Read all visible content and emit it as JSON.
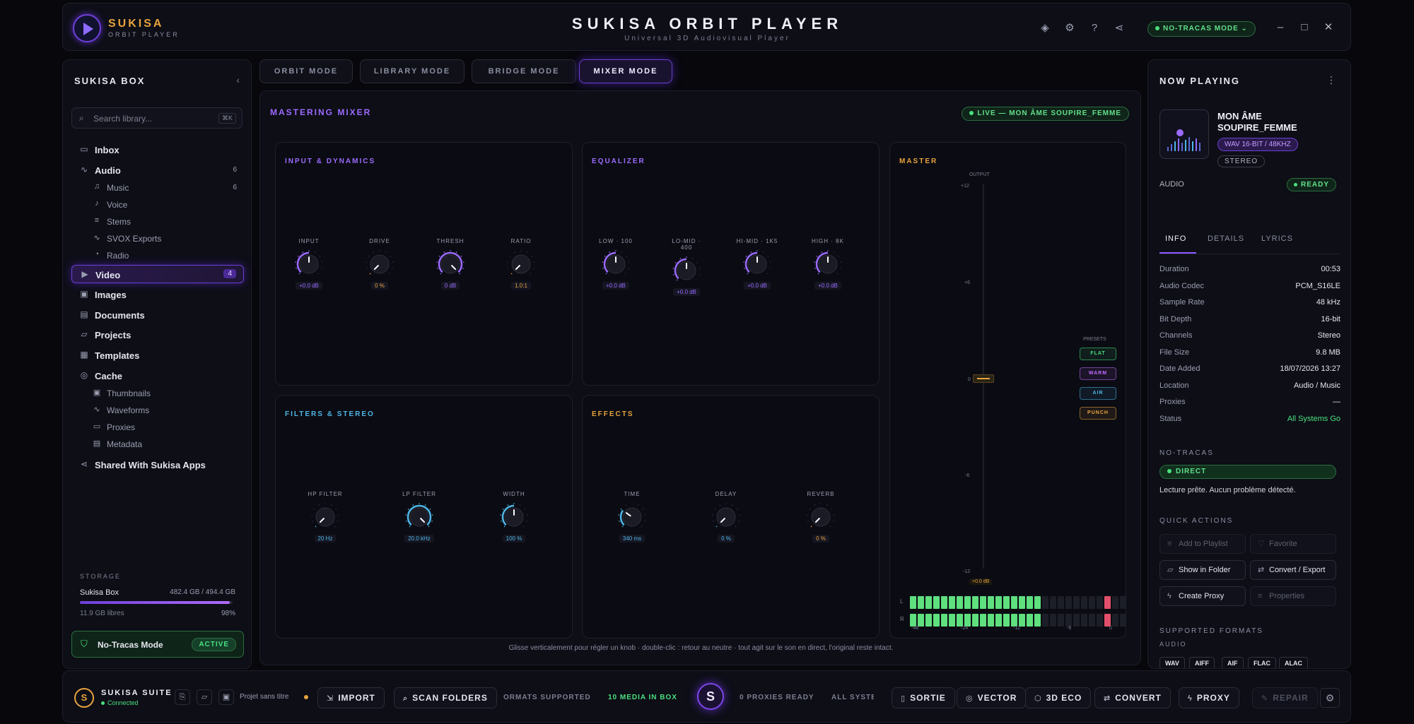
{
  "app": {
    "brand": "SUKISA",
    "brand_sub": "ORBIT PLAYER",
    "title": "SUKISA ORBIT PLAYER",
    "subtitle": "Universal 3D Audiovisual Player",
    "mode_pill": "NO-TRACAS MODE",
    "window_controls": [
      "–",
      "□",
      "✕"
    ],
    "top_icons": [
      "layers-icon",
      "gear-icon",
      "help-icon",
      "share-icon"
    ]
  },
  "sidebar": {
    "title": "SUKISA BOX",
    "collapse": "‹",
    "search_placeholder": "Search library...",
    "search_shortcut": "⌘K",
    "items": [
      {
        "label": "Inbox",
        "icon": "▭",
        "count": "",
        "sub": false,
        "active": false
      },
      {
        "label": "Audio",
        "icon": "∿",
        "count": "6",
        "sub": false,
        "active": false
      },
      {
        "label": "Music",
        "icon": "♫",
        "count": "6",
        "sub": true,
        "active": false
      },
      {
        "label": "Voice",
        "icon": "♪",
        "count": "",
        "sub": true,
        "active": false
      },
      {
        "label": "Stems",
        "icon": "≡",
        "count": "",
        "sub": true,
        "active": false
      },
      {
        "label": "SVOX Exports",
        "icon": "∿",
        "count": "",
        "sub": true,
        "active": false
      },
      {
        "label": "Radio",
        "icon": "◔",
        "count": "",
        "sub": true,
        "active": false
      },
      {
        "label": "Video",
        "icon": "▶",
        "count": "4",
        "sub": false,
        "active": true
      },
      {
        "label": "Images",
        "icon": "▣",
        "count": "",
        "sub": false,
        "active": false
      },
      {
        "label": "Documents",
        "icon": "▤",
        "count": "",
        "sub": false,
        "active": false
      },
      {
        "label": "Projects",
        "icon": "▱",
        "count": "",
        "sub": false,
        "active": false
      },
      {
        "label": "Templates",
        "icon": "▦",
        "count": "",
        "sub": false,
        "active": false
      },
      {
        "label": "Cache",
        "icon": "◎",
        "count": "",
        "sub": false,
        "active": false
      },
      {
        "label": "Thumbnails",
        "icon": "▣",
        "count": "",
        "sub": true,
        "active": false
      },
      {
        "label": "Waveforms",
        "icon": "∿",
        "count": "",
        "sub": true,
        "active": false
      },
      {
        "label": "Proxies",
        "icon": "▭",
        "count": "",
        "sub": true,
        "active": false
      },
      {
        "label": "Metadata",
        "icon": "▤",
        "count": "",
        "sub": true,
        "active": false
      },
      {
        "label": "Shared With Sukisa Apps",
        "icon": "⋖",
        "count": "",
        "sub": false,
        "active": false
      }
    ],
    "storage": {
      "title": "STORAGE",
      "name": "Sukisa Box",
      "value": "482.4 GB / 494.4 GB",
      "free": "11.9 GB libres",
      "percent": "98%",
      "fraction": 0.98
    },
    "no_tracas": {
      "label": "No-Tracas Mode",
      "status": "ACTIVE"
    }
  },
  "tabs": [
    "ORBIT MODE",
    "LIBRARY MODE",
    "BRIDGE MODE",
    "MIXER MODE"
  ],
  "active_tab": 3,
  "mixer": {
    "title": "MASTERING MIXER",
    "live": "LIVE — MON ÂME SOUPIRE_FEMME",
    "hint": "Glisse verticalement pour régler un knob · double-clic : retour au neutre · tout agit sur le son en direct, l'original reste intact.",
    "sections": [
      {
        "title": "INPUT & DYNAMICS",
        "color": "#9c6bff",
        "knobs": [
          {
            "label": "INPUT",
            "value": "+0.0 dB",
            "level": 0.5,
            "color": "#9c6bff"
          },
          {
            "label": "DRIVE",
            "value": "0 %",
            "level": 0.0,
            "color": "#e8a33d"
          },
          {
            "label": "THRESH",
            "value": "0 dB",
            "level": 1.0,
            "color": "#9c6bff"
          },
          {
            "label": "RATIO",
            "value": "1.0:1",
            "level": 0.0,
            "color": "#e8a33d"
          }
        ]
      },
      {
        "title": "EQUALIZER",
        "color": "#9c6bff",
        "knobs": [
          {
            "label": "LOW · 100",
            "value": "+0.0 dB",
            "level": 0.5,
            "color": "#9c6bff"
          },
          {
            "label": "LO-MID · 400",
            "value": "+0.0 dB",
            "level": 0.5,
            "color": "#9c6bff"
          },
          {
            "label": "HI-MID · 1K5",
            "value": "+0.0 dB",
            "level": 0.5,
            "color": "#9c6bff"
          },
          {
            "label": "HIGH · 8K",
            "value": "+0.0 dB",
            "level": 0.5,
            "color": "#9c6bff"
          }
        ]
      },
      {
        "title": "FILTERS & STEREO",
        "color": "#4fb6e8",
        "knobs": [
          {
            "label": "HP FILTER",
            "value": "20 Hz",
            "level": 0.0,
            "color": "#4fb6e8"
          },
          {
            "label": "LP FILTER",
            "value": "20.0 kHz",
            "level": 1.0,
            "color": "#4fb6e8"
          },
          {
            "label": "WIDTH",
            "value": "100 %",
            "level": 0.5,
            "color": "#4fb6e8"
          }
        ]
      },
      {
        "title": "EFFECTS",
        "color": "#e8a33d",
        "knobs": [
          {
            "label": "TIME",
            "value": "340 ms",
            "level": 0.3,
            "color": "#4fb6e8"
          },
          {
            "label": "DELAY",
            "value": "0 %",
            "level": 0.0,
            "color": "#4fb6e8"
          },
          {
            "label": "REVERB",
            "value": "0 %",
            "level": 0.0,
            "color": "#e8a33d"
          }
        ]
      }
    ],
    "master": {
      "title": "MASTER",
      "output": "OUTPUT",
      "scale": [
        "+12",
        "+6",
        "0",
        "-6",
        "-12"
      ],
      "fader_value": "+0.0 dB",
      "presets_title": "PRESETS",
      "presets": [
        {
          "label": "FLAT",
          "color": "#4be07e"
        },
        {
          "label": "WARM",
          "color": "#c56bff"
        },
        {
          "label": "AIR",
          "color": "#4fb6e8"
        },
        {
          "label": "PUNCH",
          "color": "#e8a33d"
        }
      ],
      "meter_labels": [
        "L",
        "R"
      ],
      "meter_scale": [
        "-48",
        "-24",
        "-12",
        "-6",
        "0"
      ],
      "meter_level": 0.6
    }
  },
  "now_playing": {
    "title": "NOW PLAYING",
    "track": "MON ÂME SOUPIRE_FEMME",
    "format": "WAV 16-BIT / 48KHZ",
    "channels_badge": "STEREO",
    "type": "AUDIO",
    "status": "READY",
    "tabs": [
      "INFO",
      "DETAILS",
      "LYRICS"
    ],
    "info": [
      {
        "k": "Duration",
        "v": "00:53"
      },
      {
        "k": "Audio Codec",
        "v": "PCM_S16LE"
      },
      {
        "k": "Sample Rate",
        "v": "48 kHz"
      },
      {
        "k": "Bit Depth",
        "v": "16-bit"
      },
      {
        "k": "Channels",
        "v": "Stereo"
      },
      {
        "k": "File Size",
        "v": "9.8 MB"
      },
      {
        "k": "Date Added",
        "v": "18/07/2026 13:27"
      },
      {
        "k": "Location",
        "v": "Audio / Music"
      },
      {
        "k": "Proxies",
        "v": "—"
      },
      {
        "k": "Status",
        "v": "All Systems Go"
      }
    ],
    "no_tracas_title": "NO-TRACAS",
    "direct": "DIRECT",
    "message": "Lecture prête. Aucun problème détecté.",
    "quick_actions_title": "QUICK ACTIONS",
    "quick_actions": [
      {
        "label": "Add to Playlist",
        "icon": "≡",
        "enabled": false
      },
      {
        "label": "Favorite",
        "icon": "♡",
        "enabled": false
      },
      {
        "label": "Show in Folder",
        "icon": "▱",
        "enabled": true
      },
      {
        "label": "Convert / Export",
        "icon": "⇄",
        "enabled": true
      },
      {
        "label": "Create Proxy",
        "icon": "ϟ",
        "enabled": true
      },
      {
        "label": "Properties",
        "icon": "≡",
        "enabled": false
      }
    ],
    "formats_title": "SUPPORTED FORMATS",
    "formats_sub": "AUDIO",
    "formats": [
      "WAV",
      "AIFF",
      "AIF",
      "FLAC",
      "ALAC"
    ]
  },
  "bottom": {
    "suite_name": "SUKISA SUITE",
    "suite_status": "Connected",
    "project": "Projet sans titre",
    "import": "IMPORT",
    "scan": "SCAN FOLDERS",
    "ticker_left": "ORMATS SUPPORTED",
    "media_count": "10 MEDIA IN BOX",
    "center": "S",
    "proxies": "0 PROXIES READY",
    "systems": "ALL SYSTEMS",
    "sortie": "SORTIE",
    "vector": "VECTOR",
    "eco": "3D ECO",
    "convert": "CONVERT",
    "proxy": "PROXY",
    "repair": "REPAIR"
  }
}
